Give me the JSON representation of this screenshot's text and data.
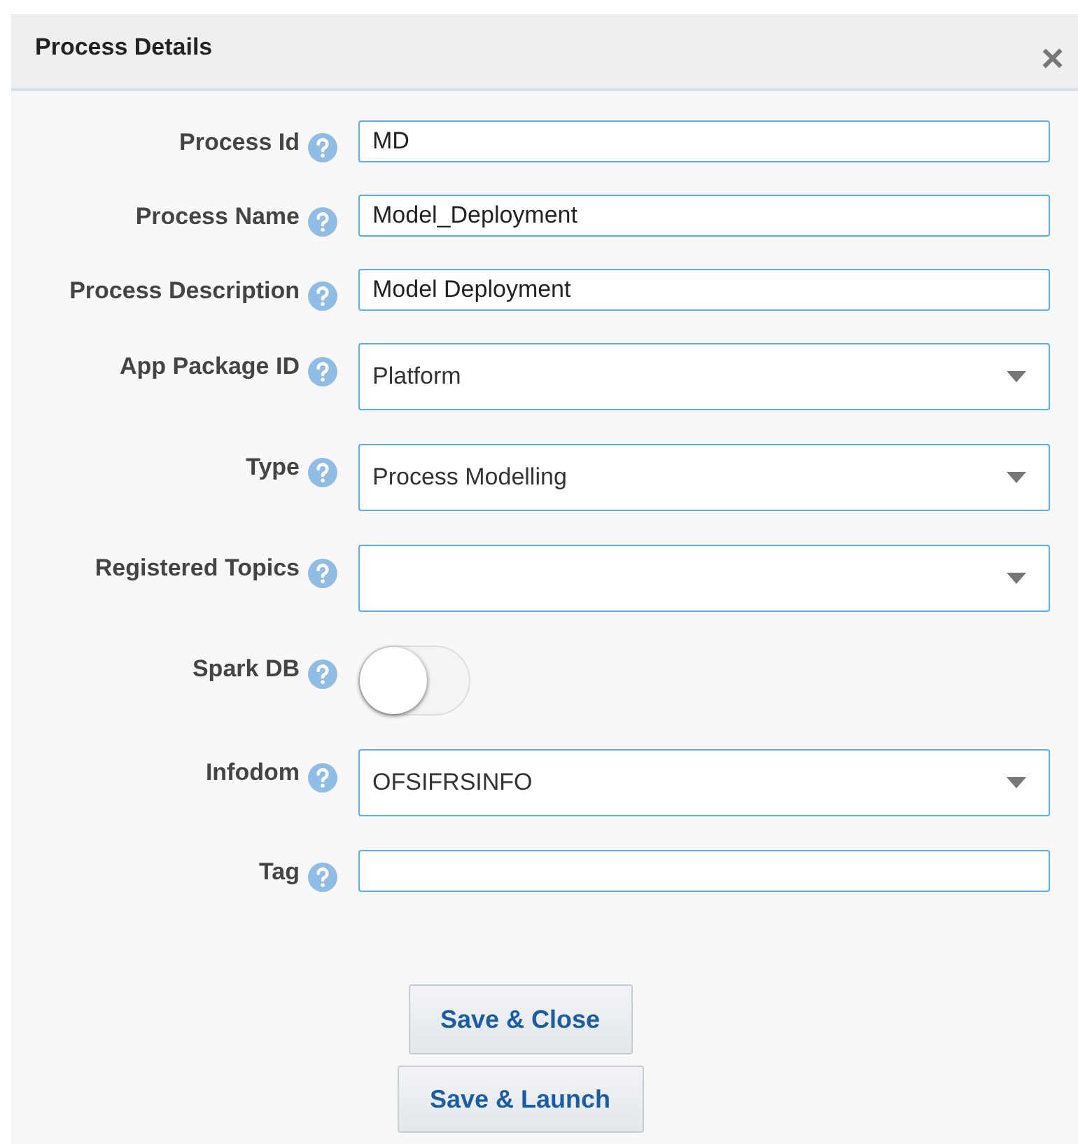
{
  "dialog": {
    "title": "Process Details",
    "close": "×"
  },
  "fields": [
    {
      "kind": "text",
      "label": "Process Id",
      "value": "MD"
    },
    {
      "kind": "text",
      "label": "Process Name",
      "value": "Model_Deployment"
    },
    {
      "kind": "text",
      "label": "Process Description",
      "value": "Model Deployment"
    },
    {
      "kind": "select",
      "label": "App Package ID",
      "value": "Platform"
    },
    {
      "kind": "select",
      "label": "Type",
      "value": "Process Modelling"
    },
    {
      "kind": "select",
      "label": "Registered Topics"
    },
    {
      "kind": "toggle",
      "label": "Spark DB",
      "on": false
    },
    {
      "kind": "select",
      "label": "Infodom",
      "value": "OFSIFRSINFO"
    },
    {
      "kind": "text",
      "label": "Tag"
    }
  ],
  "buttons": [
    "Save & Close",
    "Save & Launch"
  ]
}
